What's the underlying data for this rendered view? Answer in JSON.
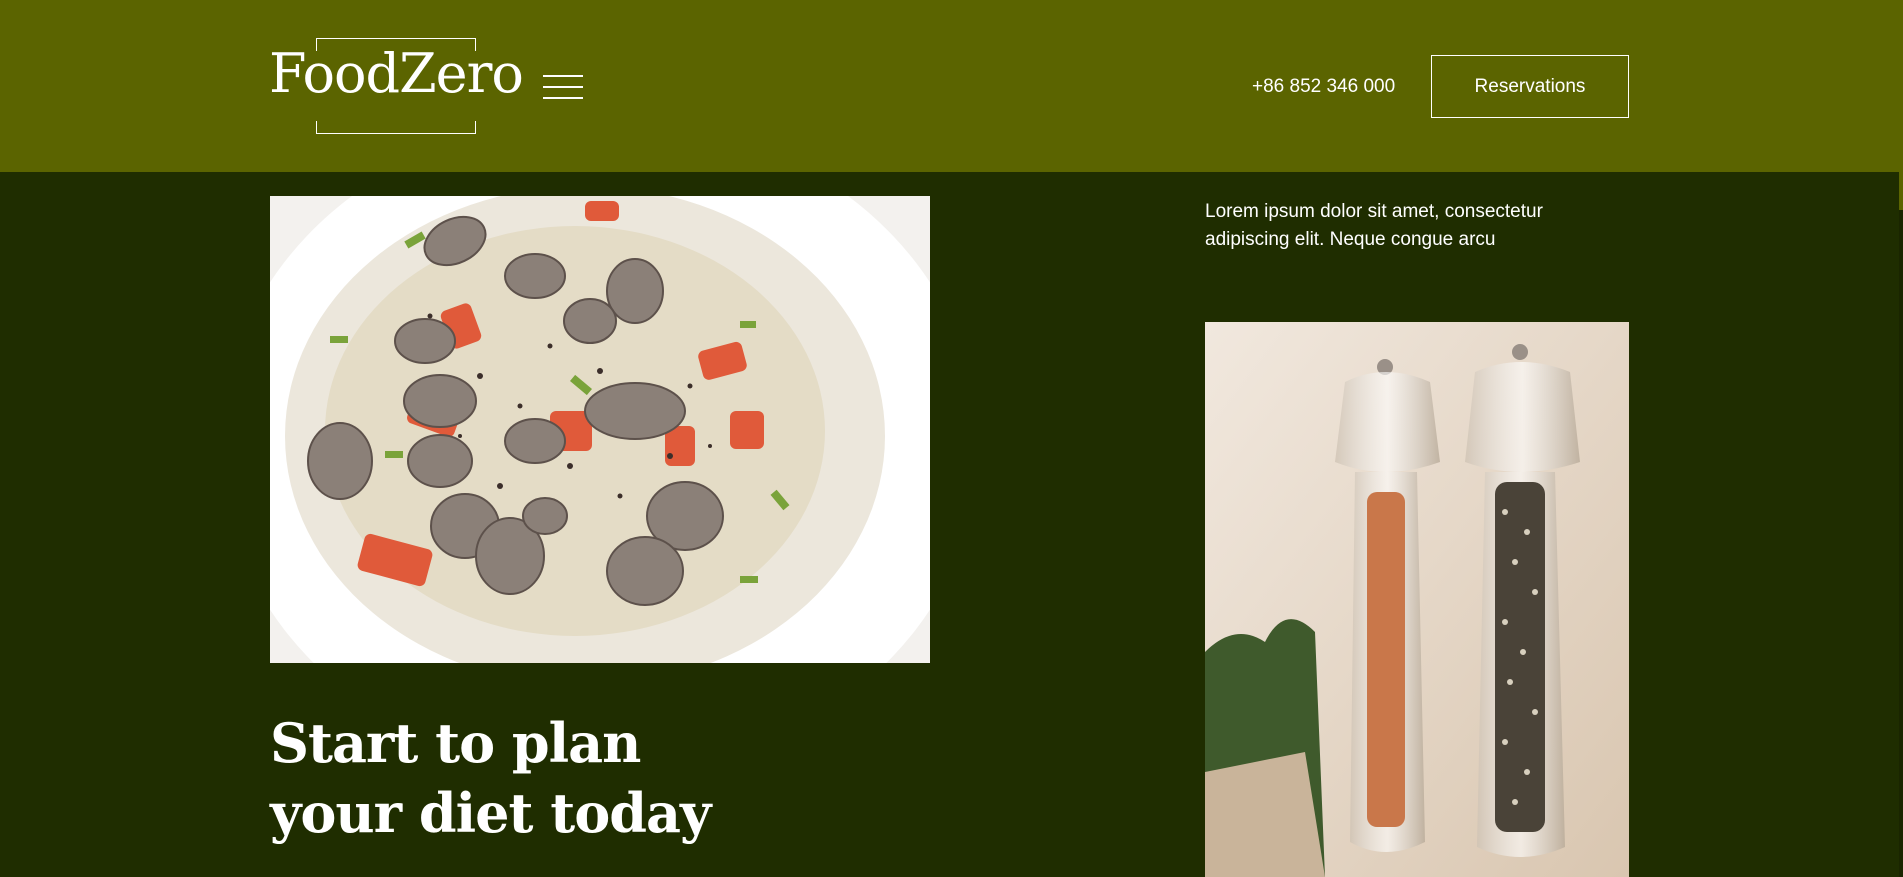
{
  "header": {
    "logo_text": "FoodZero",
    "menu_icon": "hamburger-menu-icon",
    "phone": "+86 852 346 000",
    "reservations_label": "Reservations"
  },
  "main": {
    "intro_text": "Lorem ipsum dolor sit amet, consectetur adipiscing elit. Neque congue arcu",
    "headline_line1": "Start to plan",
    "headline_line2": "your diet today",
    "images": {
      "soup": "clam-chowder-photo",
      "pepper": "salt-and-pepper-mills-photo"
    }
  },
  "colors": {
    "header_bg": "#5b6400",
    "page_bg": "#1f2d00",
    "text": "#ffffff"
  }
}
